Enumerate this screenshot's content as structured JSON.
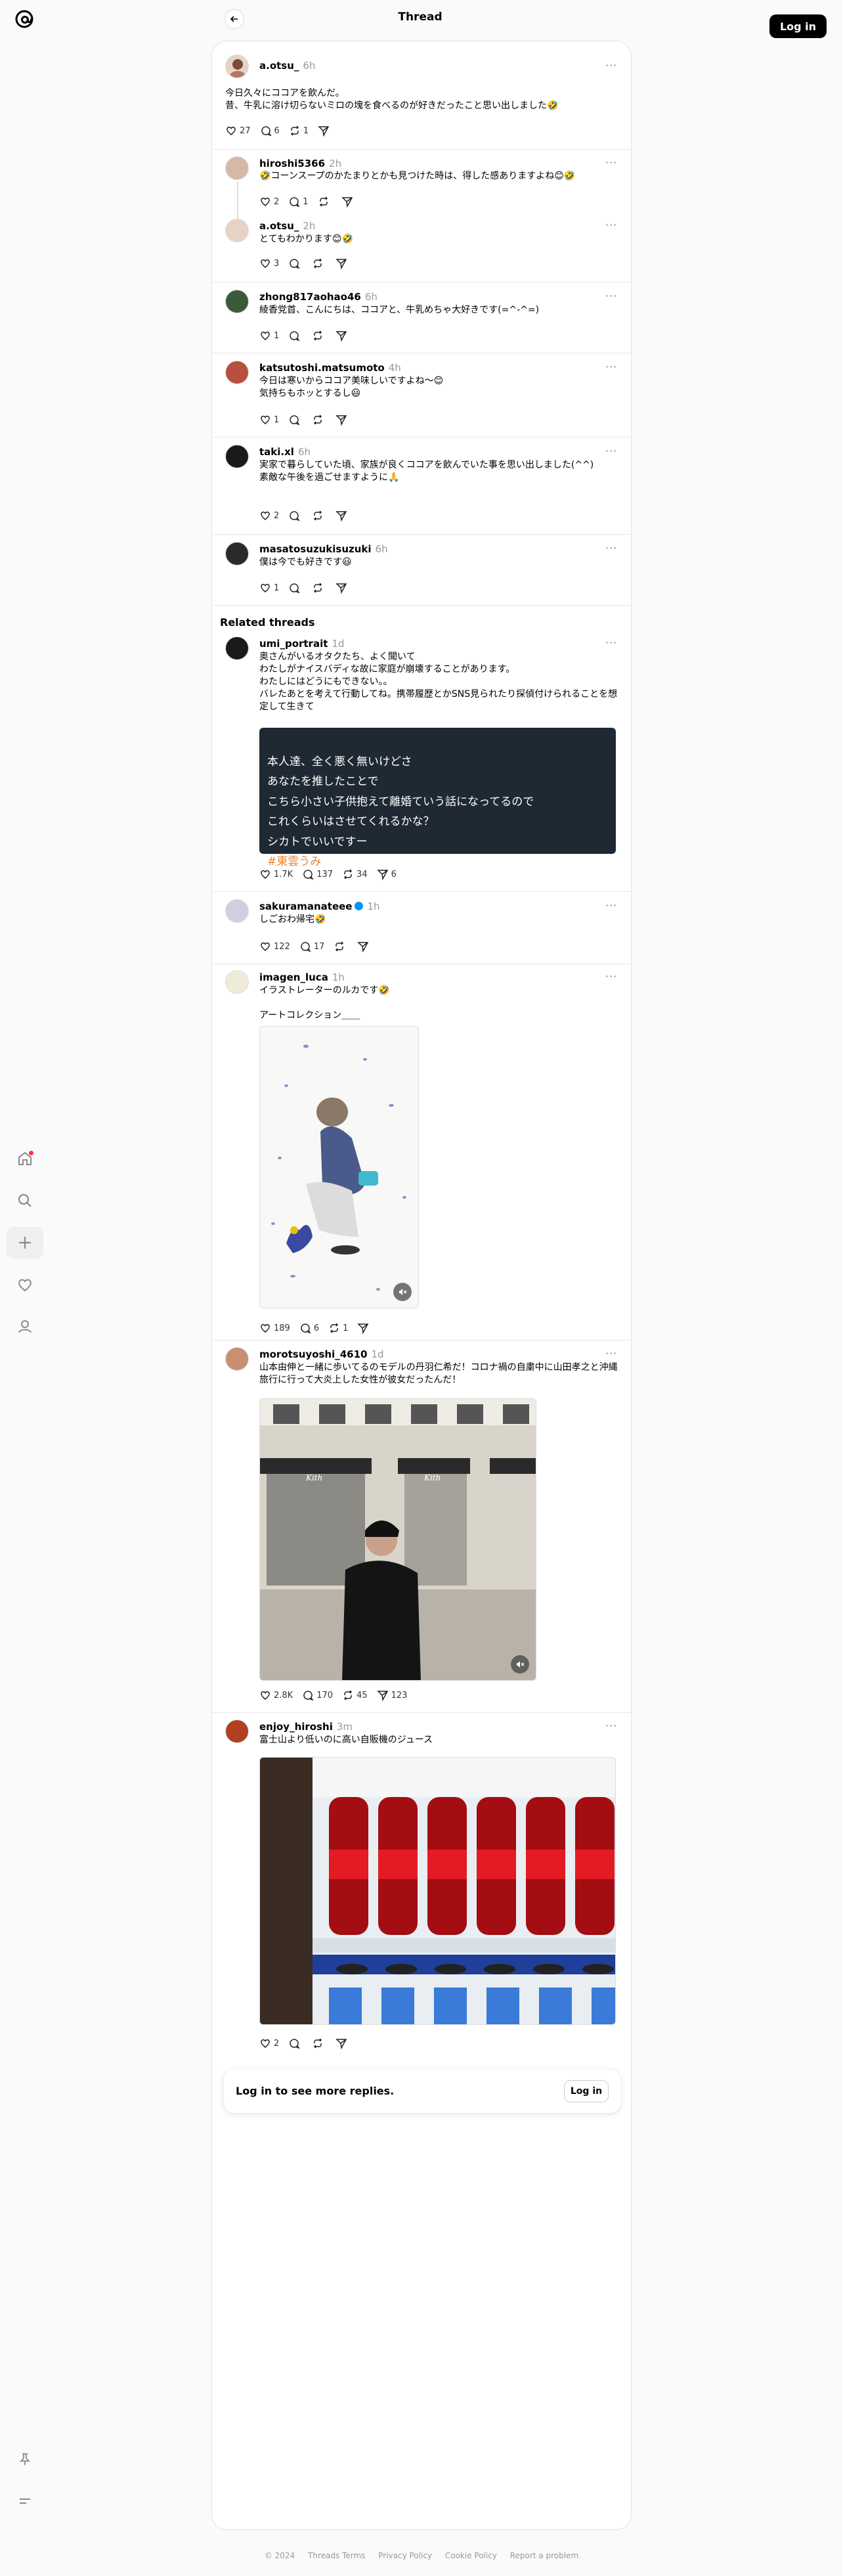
{
  "header": {
    "title": "Thread",
    "login_label": "Log in"
  },
  "colors": {
    "accent": "#000000",
    "notif_dot": "#ff3040",
    "verified": "#0095f6",
    "hashtag": "#f0852d"
  },
  "icons": {
    "logo": "threads-logo-icon",
    "back": "arrow-left-icon",
    "nav": [
      "home-icon",
      "search-icon",
      "plus-icon",
      "heart-icon",
      "user-icon"
    ],
    "nav_bottom": [
      "pin-icon",
      "menu-icon"
    ]
  },
  "main_post": {
    "username": "a.otsu_",
    "time": "6h",
    "text": "今日久々にココアを飲んだ。\n昔、牛乳に溶け切らないミロの塊を食べるのが好きだったこと思い出しました🤣",
    "likes": "27",
    "replies": "6",
    "reposts": "1"
  },
  "replies": [
    {
      "username": "hiroshi5366",
      "time": "2h",
      "text": "🤣コーンスープのかたまりとかも見つけた時は、得した感ありますよね😊🤣",
      "likes": "2",
      "replies": "1",
      "reposts": "",
      "shares": ""
    },
    {
      "username": "a.otsu_",
      "time": "2h",
      "text": "とてもわかります😊🤣",
      "likes": "3",
      "replies": "",
      "reposts": "",
      "shares": ""
    },
    {
      "username": "zhong817aohao46",
      "time": "6h",
      "text": "綾香党首、こんにちは、ココアと、牛乳めちゃ大好きです(=^-^=)",
      "likes": "1",
      "replies": "",
      "reposts": "",
      "shares": ""
    },
    {
      "username": "katsutoshi.matsumoto",
      "time": "4h",
      "text": "今日は寒いからココア美味しいですよね〜😊\n気持ちもホッとするし😃",
      "likes": "1",
      "replies": "",
      "reposts": "",
      "shares": ""
    },
    {
      "username": "taki.xl",
      "time": "6h",
      "text": "実家で暮らしていた頃、家族が良くココアを飲んでいた事を思い出しました(^^)\n素敵な午後を過ごせますように🙏",
      "likes": "2",
      "replies": "",
      "reposts": "",
      "shares": ""
    },
    {
      "username": "masatosuzukisuzuki",
      "time": "6h",
      "text": "僕は今でも好きです😃",
      "likes": "1",
      "replies": "",
      "reposts": "",
      "shares": ""
    }
  ],
  "related_title": "Related threads",
  "related": [
    {
      "username": "umi_portrait",
      "time": "1d",
      "text": "奥さんがいるオタクたち、よく聞いて\nわたしがナイスバディな故に家庭が崩壊することがあります。\nわたしにはどうにもできない。。\nバレたあとを考えて行動してね。携帯履歴とかSNS見られたり探偵付けられることを想定して生きて",
      "quote": "本人達、全く悪く無いけどさ\nあなたを推したことで\nこちら小さい子供抱えて離婚ていう話になってるので\nこれくらいはさせてくれるかな？\nシカトでいいですー",
      "hashtag": "#東雲うみ",
      "likes": "1.7K",
      "replies": "137",
      "reposts": "34",
      "shares": "6"
    },
    {
      "username": "sakuramanateee",
      "time": "1h",
      "verified": true,
      "text": "しごおわ帰宅🤣",
      "likes": "122",
      "replies": "17",
      "reposts": "",
      "shares": ""
    },
    {
      "username": "imagen_luca",
      "time": "1h",
      "text": "イラストレーターのルカです🤣\n\nアートコレクション＿＿",
      "likes": "189",
      "replies": "6",
      "reposts": "1",
      "shares": ""
    },
    {
      "username": "morotsuyoshi_4610",
      "time": "1d",
      "text": "山本由伸と一緒に歩いてるのモデルの丹羽仁希だ！コロナ禍の自粛中に山田孝之と沖縄旅行に行って大炎上した女性が彼女だったんだ！",
      "likes": "2.8K",
      "replies": "170",
      "reposts": "45",
      "shares": "123"
    },
    {
      "username": "enjoy_hiroshi",
      "time": "3m",
      "text": "富士山より低いのに高い自販機のジュース",
      "likes": "2",
      "replies": "",
      "reposts": "",
      "shares": ""
    }
  ],
  "media_text": {
    "store_sign": "Kith"
  },
  "login_card": {
    "text": "Log in to see more replies.",
    "button": "Log in"
  },
  "footer": {
    "copyright": "© 2024",
    "links": [
      "Threads Terms",
      "Privacy Policy",
      "Cookie Policy",
      "Report a problem"
    ]
  }
}
